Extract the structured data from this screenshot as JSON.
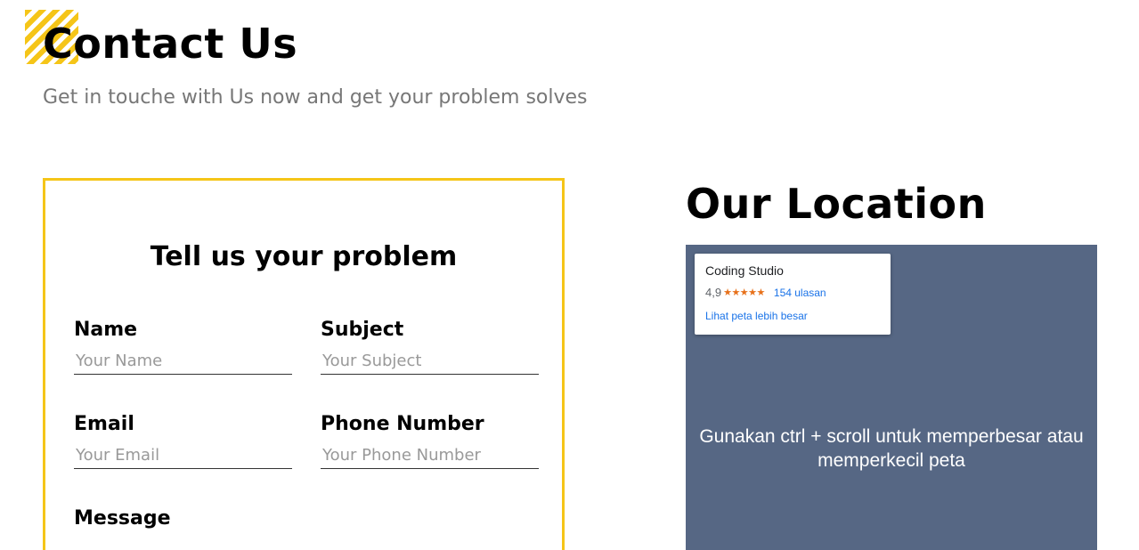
{
  "header": {
    "title": "Contact Us",
    "subtitle": "Get in touche with Us now and get your problem solves"
  },
  "form": {
    "heading": "Tell us your problem",
    "fields": {
      "name": {
        "label": "Name",
        "placeholder": "Your Name"
      },
      "subject": {
        "label": "Subject",
        "placeholder": "Your Subject"
      },
      "email": {
        "label": "Email",
        "placeholder": "Your Email"
      },
      "phone": {
        "label": "Phone Number",
        "placeholder": "Your Phone Number"
      },
      "message": {
        "label": "Message"
      }
    }
  },
  "location": {
    "title": "Our Location",
    "map": {
      "place_name": "Coding Studio",
      "rating": "4,9",
      "stars": "★★★★★",
      "reviews": "154 ulasan",
      "larger_map_link": "Lihat peta lebih besar",
      "hint": "Gunakan ctrl + scroll untuk memperbesar atau memperkecil peta"
    }
  },
  "colors": {
    "accent": "#f5c518",
    "map_overlay": "#566784",
    "link": "#1a73e8",
    "star": "#e7711b"
  }
}
